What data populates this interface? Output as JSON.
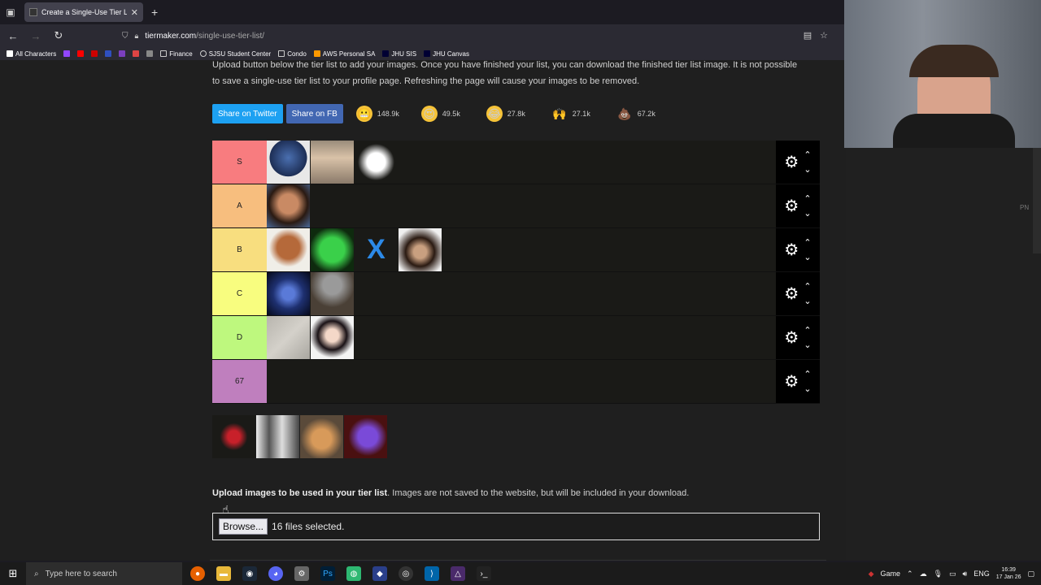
{
  "browser": {
    "tab_title": "Create a Single-Use Tier List (F",
    "url_host": "tiermaker.com",
    "url_path": "/single-use-tier-list/",
    "bookmarks": [
      "All Characters",
      "Finance",
      "SJSU Student Center",
      "Condo",
      "AWS Personal SA",
      "JHU SIS",
      "JHU Canvas"
    ]
  },
  "intro": {
    "line1": "Upload button below the tier list to add your images. Once you have finished your list, you can download the finished tier list image. It is not possible",
    "line2": "to save a single-use tier list to your profile page. Refreshing the page will cause your images to be removed."
  },
  "share": {
    "twitter": "Share on Twitter",
    "facebook": "Share on FB",
    "reactions": [
      {
        "icon": "grimace-emoji-icon",
        "count": "148.9k"
      },
      {
        "icon": "heart-eyes-emoji-icon",
        "count": "49.5k"
      },
      {
        "icon": "laughing-emoji-icon",
        "count": "27.8k"
      },
      {
        "icon": "raised-hands-emoji-icon",
        "count": "27.1k"
      },
      {
        "icon": "poop-emoji-icon",
        "count": "67.2k"
      }
    ]
  },
  "tiers": [
    {
      "label": "S",
      "color": "#f87c7f",
      "items": 3
    },
    {
      "label": "A",
      "color": "#f7be7e",
      "items": 1
    },
    {
      "label": "B",
      "color": "#f8de7f",
      "items": 4
    },
    {
      "label": "C",
      "color": "#f8fd7f",
      "items": 2
    },
    {
      "label": "D",
      "color": "#bef87e",
      "items": 2
    },
    {
      "label": "67",
      "color": "#bf7fbe",
      "items": 0
    }
  ],
  "pool_items": 4,
  "upload": {
    "bold": "Upload images to be used in your tier list",
    "rest": ". Images are not saved to the website, but will be included in your download.",
    "browse_label": "Browse...",
    "status": "16 files selected."
  },
  "side": {
    "pn": "PN"
  },
  "taskbar": {
    "search_placeholder": "Type here to search",
    "game_label": "Game",
    "lang": "ENG",
    "time": "16:39",
    "date": "17 Jan 26"
  }
}
